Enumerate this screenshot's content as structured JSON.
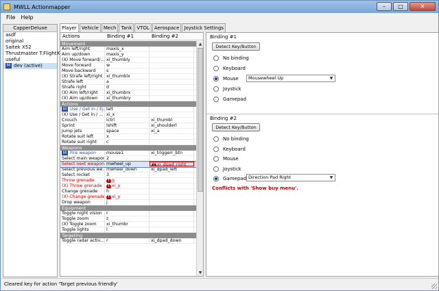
{
  "window": {
    "title": "MWLL Actionmapper"
  },
  "menu": [
    "File",
    "Help"
  ],
  "profiles": {
    "header": "CapperDeluxe",
    "items": [
      {
        "label": "asdf",
        "active": false
      },
      {
        "label": "original",
        "active": false
      },
      {
        "label": "Saitek X52",
        "active": false
      },
      {
        "label": "Thrustmaster T.FlightX",
        "active": false
      },
      {
        "label": "useful",
        "active": false
      },
      {
        "label": "dev (active)",
        "active": true,
        "badge": "M"
      }
    ]
  },
  "tabs": [
    "Player",
    "Vehicle",
    "Mech",
    "Tank",
    "VTOL",
    "Aerospace",
    "Joystick Settings"
  ],
  "table": {
    "headers": [
      "Actions",
      "Binding #1",
      "Binding #2"
    ],
    "sections": [
      {
        "title": "Movement",
        "rows": [
          {
            "action": "Aim left/right",
            "b1": "maxis_x",
            "b2": ""
          },
          {
            "action": "Aim up/down",
            "b1": "maxis_y",
            "b2": ""
          },
          {
            "action": "(X) Move forward/...",
            "b1": "xi_thumbly",
            "b2": ""
          },
          {
            "action": "Move forward",
            "b1": "w",
            "b2": ""
          },
          {
            "action": "Move backward",
            "b1": "s",
            "b2": ""
          },
          {
            "action": "(X) Strafe left/right",
            "b1": "xi_thumblx",
            "b2": ""
          },
          {
            "action": "Strafe left",
            "b1": "a",
            "b2": ""
          },
          {
            "action": "Strafe right",
            "b1": "d",
            "b2": ""
          },
          {
            "action": "(X) Aim left/right",
            "b1": "xi_thumbrx",
            "b2": ""
          },
          {
            "action": "(X) Aim up/down",
            "b1": "xi_thumbry",
            "b2": ""
          }
        ]
      },
      {
        "title": "Actions",
        "rows": [
          {
            "action": "Use / Get in / Ej...",
            "b1": "lalt",
            "b2": "",
            "badge": "M",
            "blue": true
          },
          {
            "action": "(X) Use / Get in / ...",
            "b1": "xi_x",
            "b2": ""
          },
          {
            "action": "Crouch",
            "b1": "lctrl",
            "b2": "xi_thumbl"
          },
          {
            "action": "Sprint",
            "b1": "lshift",
            "b2": "xi_shoulderl"
          },
          {
            "action": "Jump jets",
            "b1": "space",
            "b2": "xi_a"
          },
          {
            "action": "Rotate suit left",
            "b1": "x",
            "b2": ""
          },
          {
            "action": "Rotate suit right",
            "b1": "c",
            "b2": ""
          }
        ]
      },
      {
        "title": "Weapons",
        "rows": [
          {
            "action": "Fire weapon",
            "b1": "mouse1",
            "b2": "xi_triggerr_btn",
            "badge": "M",
            "blue": true
          },
          {
            "action": "Select main weapon",
            "b1": "2",
            "b2": ""
          },
          {
            "action": "Select next weapon",
            "b1": "mwheel_up",
            "b2": "xi_dpad_right",
            "selected": true,
            "warn2": true
          },
          {
            "action": "Select previous we...",
            "b1": "mwheel_down",
            "b2": "xi_dpad_left"
          },
          {
            "action": "Select rocket",
            "b1": "3",
            "b2": ""
          },
          {
            "action": "Throw grenade",
            "b1": "g",
            "b2": "",
            "conflict": true,
            "warn1": true
          },
          {
            "action": "(X) Throw grenade",
            "b1": "xi_y",
            "b2": "",
            "conflict": true,
            "warn1": true
          },
          {
            "action": "Change grenade",
            "b1": "h",
            "b2": ""
          },
          {
            "action": "(X) Change grenade",
            "b1": "xi_y",
            "b2": "",
            "conflict": true,
            "warn1": true
          },
          {
            "action": "Drop weapon",
            "b1": "j",
            "b2": ""
          }
        ]
      },
      {
        "title": "Equipment",
        "rows": [
          {
            "action": "Toggle night vision",
            "b1": "r",
            "b2": ""
          },
          {
            "action": "Toggle zoom",
            "b1": "z",
            "b2": ""
          },
          {
            "action": "(X) Toggle zoom",
            "b1": "xi_thumbr",
            "b2": ""
          },
          {
            "action": "Toggle lights",
            "b1": "l",
            "b2": ""
          }
        ]
      },
      {
        "title": "Targeting",
        "rows": [
          {
            "action": "Toggle radar activ...",
            "b1": "r",
            "b2": "xi_dpad_down"
          }
        ]
      }
    ]
  },
  "binding1": {
    "title": "Binding #1",
    "detect_label": "Detect Key/Button",
    "options": [
      "No binding",
      "Keyboard",
      "Mouse",
      "Joystick",
      "Gamepad"
    ],
    "selected": "Mouse",
    "select_value": "Mousewheel Up"
  },
  "binding2": {
    "title": "Binding #2",
    "detect_label": "Detect Key/Button",
    "options": [
      "No binding",
      "Keyboard",
      "Mouse",
      "Joystick",
      "Gamepad"
    ],
    "selected": "Gamepad",
    "select_value": "Direction Pad Right",
    "conflict_text": "Conflicts with 'Show buy menu'."
  },
  "status": "Cleared key for action 'Target previous friendly'",
  "colors": {
    "conflict": "#c00000",
    "accent": "#2a4aa8",
    "section": "#8c8c8c"
  }
}
